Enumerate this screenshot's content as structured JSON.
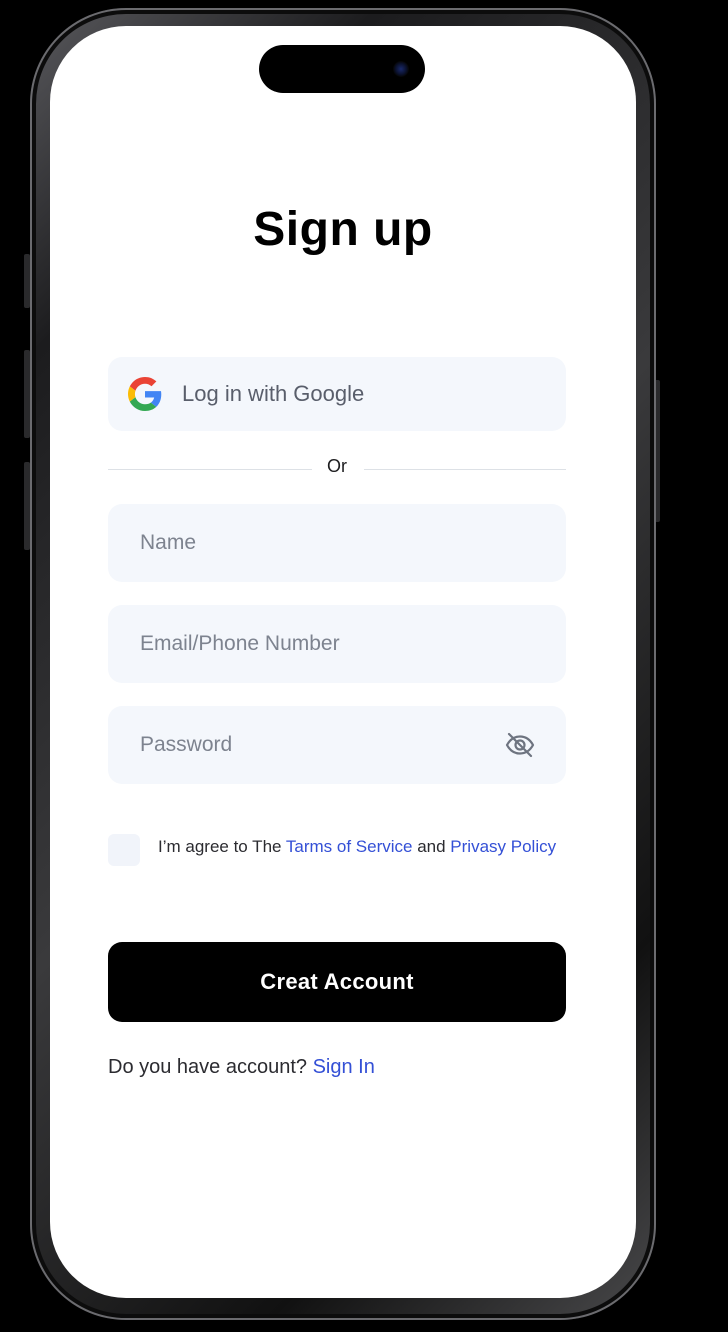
{
  "title": "Sign up",
  "google_button": {
    "label": "Log in with Google",
    "icon": "google-logo-icon"
  },
  "divider": {
    "text": "Or"
  },
  "fields": {
    "name": {
      "placeholder": "Name",
      "value": ""
    },
    "email": {
      "placeholder": "Email/Phone Number",
      "value": ""
    },
    "password": {
      "placeholder": "Password",
      "value": "",
      "toggle_icon": "eye-off-icon"
    }
  },
  "agreement": {
    "prefix": "I’m agree to The ",
    "terms_link": "Tarms of Service",
    "middle": " and ",
    "privacy_link": "Privasy Policy",
    "checked": false
  },
  "create_button": {
    "label": "Creat Account"
  },
  "signin": {
    "prompt": "Do you have account? ",
    "link": "Sign In"
  },
  "colors": {
    "accent": "#3450d6",
    "field_bg": "#f4f7fc",
    "button_bg": "#000000",
    "background": "#ffffff"
  }
}
